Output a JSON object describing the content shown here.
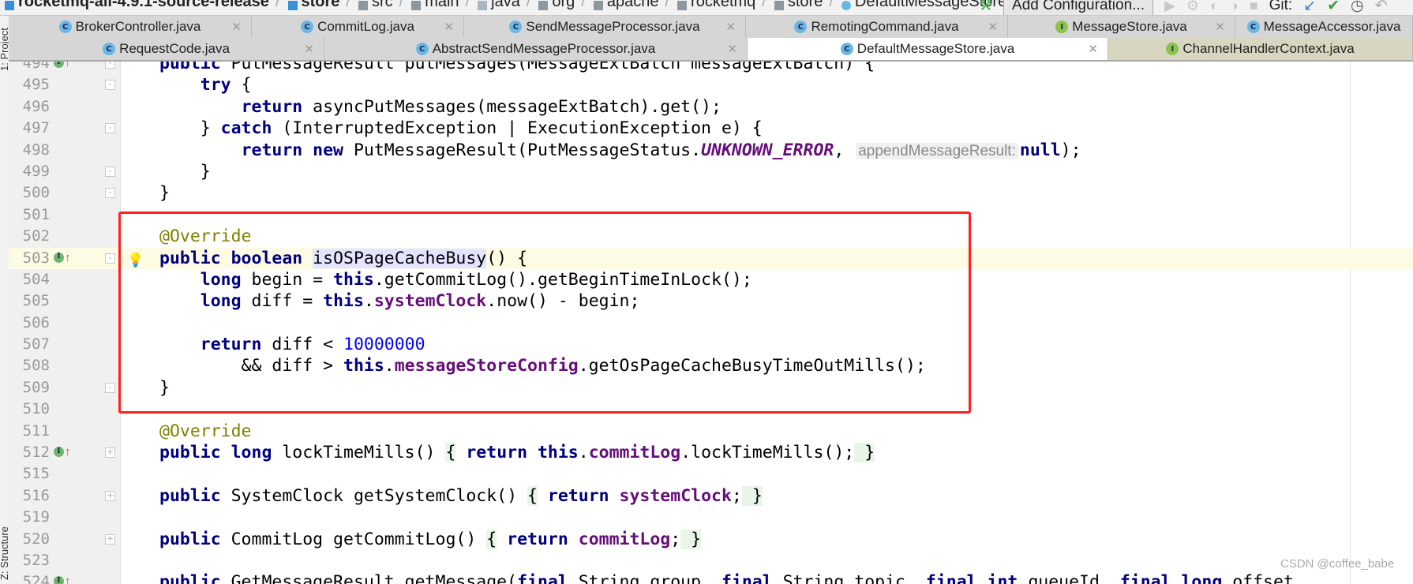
{
  "breadcrumb": [
    {
      "label": "rocketmq-all-4.9.1-source-release",
      "icon": "module-folder-icon",
      "bold": true
    },
    {
      "label": "store",
      "icon": "module-folder-icon",
      "bold": true
    },
    {
      "label": "src",
      "icon": "folder-icon"
    },
    {
      "label": "main",
      "icon": "folder-icon"
    },
    {
      "label": "java",
      "icon": "source-folder-icon"
    },
    {
      "label": "org",
      "icon": "package-icon"
    },
    {
      "label": "apache",
      "icon": "package-icon"
    },
    {
      "label": "rocketmq",
      "icon": "package-icon"
    },
    {
      "label": "store",
      "icon": "package-icon"
    },
    {
      "label": "DefaultMessageStore",
      "icon": "class-icon"
    }
  ],
  "toolbar": {
    "add_configuration": "Add Configuration...",
    "git_label": "Git:"
  },
  "left_strip": {
    "project": "1: Project",
    "structure": "Z: Structure"
  },
  "tabs_row1": [
    {
      "label": "BrokerController.java",
      "kind": "C"
    },
    {
      "label": "CommitLog.java",
      "kind": "C"
    },
    {
      "label": "SendMessageProcessor.java",
      "kind": "C"
    },
    {
      "label": "RemotingCommand.java",
      "kind": "C"
    },
    {
      "label": "MessageStore.java",
      "kind": "I"
    },
    {
      "label": "MessageAccessor.java",
      "kind": "C"
    }
  ],
  "tabs_row2": [
    {
      "label": "RequestCode.java",
      "kind": "C"
    },
    {
      "label": "AbstractSendMessageProcessor.java",
      "kind": "C"
    },
    {
      "label": "DefaultMessageStore.java",
      "kind": "C",
      "active": true
    },
    {
      "label": "ChannelHandlerContext.java",
      "kind": "I"
    }
  ],
  "code_lines": [
    {
      "n": "494",
      "mark": true,
      "fold": "-",
      "t": [
        [
          "public ",
          "kw"
        ],
        [
          "PutMessageResult putMessages(MessageExtBatch messageExtBatch) {",
          ""
        ]
      ]
    },
    {
      "n": "495",
      "fold": "-",
      "t": [
        [
          "    ",
          ""
        ],
        [
          "try",
          "kw"
        ],
        [
          " {",
          ""
        ]
      ]
    },
    {
      "n": "496",
      "t": [
        [
          "        ",
          ""
        ],
        [
          "return",
          "kw"
        ],
        [
          " asyncPutMessages(messageExtBatch).get();",
          ""
        ]
      ]
    },
    {
      "n": "497",
      "fold": "-",
      "t": [
        [
          "    } ",
          ""
        ],
        [
          "catch",
          "kw"
        ],
        [
          " (InterruptedException | ExecutionException e) {",
          ""
        ]
      ]
    },
    {
      "n": "498",
      "t": [
        [
          "        ",
          ""
        ],
        [
          "return new",
          "kw"
        ],
        [
          " PutMessageResult(PutMessageStatus.",
          ""
        ],
        [
          "UNKNOWN_ERROR",
          "st"
        ],
        [
          ", ",
          ""
        ],
        [
          "appendMessageResult:",
          "hint"
        ],
        [
          "null",
          "kw"
        ],
        [
          ");",
          ""
        ]
      ]
    },
    {
      "n": "499",
      "fold": "-",
      "t": [
        [
          "    }",
          ""
        ]
      ]
    },
    {
      "n": "500",
      "fold": "-",
      "t": [
        [
          "}",
          ""
        ]
      ]
    },
    {
      "n": "501",
      "t": []
    },
    {
      "n": "502",
      "t": [
        [
          "@Override",
          "ann"
        ]
      ]
    },
    {
      "n": "503",
      "mark": true,
      "fold": "-",
      "bulb": true,
      "current": true,
      "t": [
        [
          "public boolean",
          "kw"
        ],
        [
          " ",
          ""
        ],
        [
          "isOSPageCacheBusy",
          "sel"
        ],
        [
          "() {",
          ""
        ]
      ]
    },
    {
      "n": "504",
      "t": [
        [
          "    ",
          ""
        ],
        [
          "long",
          "kw"
        ],
        [
          " begin = ",
          ""
        ],
        [
          "this",
          "kw"
        ],
        [
          ".getCommitLog().getBeginTimeInLock();",
          ""
        ]
      ]
    },
    {
      "n": "505",
      "t": [
        [
          "    ",
          ""
        ],
        [
          "long",
          "kw"
        ],
        [
          " diff = ",
          ""
        ],
        [
          "this",
          "kw"
        ],
        [
          ".",
          ""
        ],
        [
          "systemClock",
          "fld"
        ],
        [
          ".now() - begin;",
          ""
        ]
      ]
    },
    {
      "n": "506",
      "t": []
    },
    {
      "n": "507",
      "t": [
        [
          "    ",
          ""
        ],
        [
          "return",
          "kw"
        ],
        [
          " diff < ",
          ""
        ],
        [
          "10000000",
          "num"
        ]
      ]
    },
    {
      "n": "508",
      "t": [
        [
          "        && diff > ",
          ""
        ],
        [
          "this",
          "kw"
        ],
        [
          ".",
          ""
        ],
        [
          "messageStoreConfig",
          "fld"
        ],
        [
          ".getOsPageCacheBusyTimeOutMills();",
          ""
        ]
      ]
    },
    {
      "n": "509",
      "fold": "-",
      "t": [
        [
          "}",
          ""
        ]
      ]
    },
    {
      "n": "510",
      "t": []
    },
    {
      "n": "511",
      "t": [
        [
          "@Override",
          "ann"
        ]
      ]
    },
    {
      "n": "512",
      "mark": true,
      "fold": "+",
      "t": [
        [
          "public long",
          "kw"
        ],
        [
          " lockTimeMills() ",
          ""
        ],
        [
          "{",
          "fb"
        ],
        [
          " ",
          ""
        ],
        [
          "return this",
          "kw"
        ],
        [
          ".",
          ""
        ],
        [
          "commitLog",
          "fld"
        ],
        [
          ".lockTimeMills();",
          ""
        ],
        [
          " }",
          "fb"
        ]
      ]
    },
    {
      "n": "515",
      "t": []
    },
    {
      "n": "516",
      "fold": "+",
      "t": [
        [
          "public",
          "kw"
        ],
        [
          " SystemClock getSystemClock() ",
          ""
        ],
        [
          "{",
          "fb"
        ],
        [
          " ",
          ""
        ],
        [
          "return",
          "kw"
        ],
        [
          " ",
          ""
        ],
        [
          "systemClock",
          "fld"
        ],
        [
          ";",
          ""
        ],
        [
          " }",
          "fb"
        ]
      ]
    },
    {
      "n": "519",
      "t": []
    },
    {
      "n": "520",
      "fold": "+",
      "t": [
        [
          "public",
          "kw"
        ],
        [
          " CommitLog getCommitLog() ",
          ""
        ],
        [
          "{",
          "fb"
        ],
        [
          " ",
          ""
        ],
        [
          "return",
          "kw"
        ],
        [
          " ",
          ""
        ],
        [
          "commitLog",
          "fld"
        ],
        [
          ";",
          ""
        ],
        [
          " }",
          "fb"
        ]
      ]
    },
    {
      "n": "523",
      "t": []
    },
    {
      "n": "524",
      "mark": true,
      "t": [
        [
          "public",
          "kw"
        ],
        [
          " GetMessageResult getMessage(",
          ""
        ],
        [
          "final",
          "kw"
        ],
        [
          " String group, ",
          ""
        ],
        [
          "final",
          "kw"
        ],
        [
          " String topic, ",
          ""
        ],
        [
          "final int",
          "kw"
        ],
        [
          " queueId, ",
          ""
        ],
        [
          "final long",
          "kw"
        ],
        [
          " offset,",
          ""
        ]
      ]
    }
  ],
  "watermark": "CSDN @coffee_babe",
  "colors": {
    "annotation_box": "#ff1f1f",
    "keyword": "#000080",
    "field": "#660e7a",
    "number": "#0000ff",
    "annotation": "#808000"
  }
}
